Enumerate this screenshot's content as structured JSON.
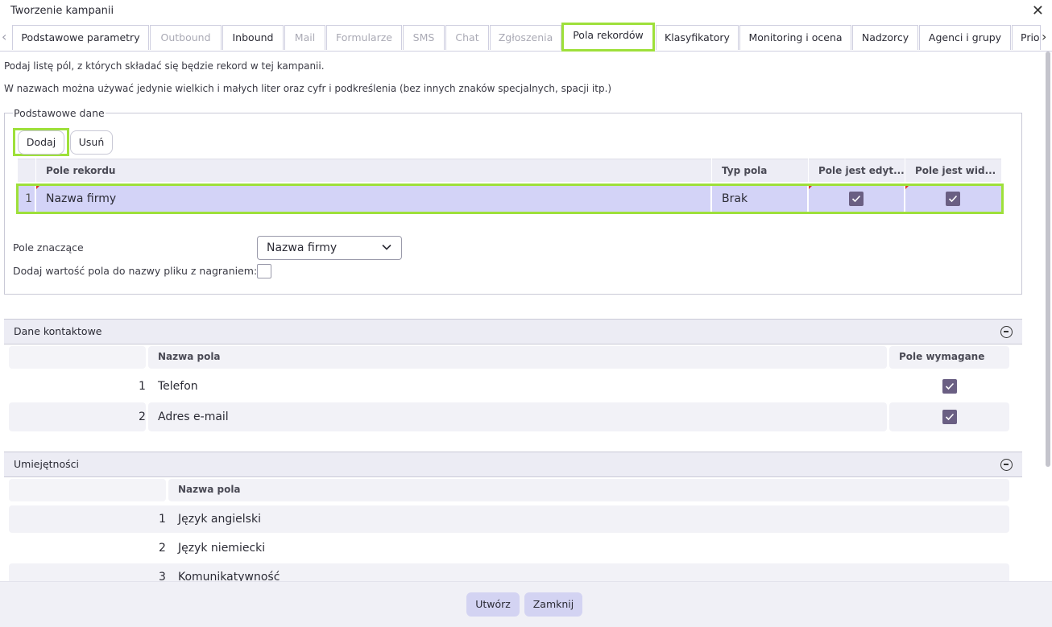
{
  "window": {
    "title": "Tworzenie kampanii"
  },
  "tabs": [
    {
      "label": "Podstawowe parametry",
      "state": "normal"
    },
    {
      "label": "Outbound",
      "state": "disabled"
    },
    {
      "label": "Inbound",
      "state": "normal"
    },
    {
      "label": "Mail",
      "state": "disabled"
    },
    {
      "label": "Formularze",
      "state": "disabled"
    },
    {
      "label": "SMS",
      "state": "disabled"
    },
    {
      "label": "Chat",
      "state": "disabled"
    },
    {
      "label": "Zgłoszenia",
      "state": "disabled"
    },
    {
      "label": "Pola rekordów",
      "state": "active"
    },
    {
      "label": "Klasyfikatory",
      "state": "normal"
    },
    {
      "label": "Monitoring i ocena",
      "state": "normal"
    },
    {
      "label": "Nadzorcy",
      "state": "normal"
    },
    {
      "label": "Agenci i grupy",
      "state": "normal"
    },
    {
      "label": "Prio",
      "state": "normal"
    }
  ],
  "intro": {
    "line1": "Podaj listę pól, z których składać się będzie rekord w tej kampanii.",
    "line2": "W nazwach można używać jedynie wielkich i małych liter oraz cyfr i podkreślenia (bez innych znaków specjalnych, spacji itp.)"
  },
  "basic": {
    "legend": "Podstawowe dane",
    "add_label": "Dodaj",
    "remove_label": "Usuń",
    "columns": [
      "Pole rekordu",
      "Typ pola",
      "Pole jest edyt...",
      "Pole jest wid..."
    ],
    "rows": [
      {
        "index": "1",
        "name": "Nazwa firmy",
        "type": "Brak",
        "editable": true,
        "visible": true
      }
    ],
    "significant_label": "Pole znaczące",
    "significant_value": "Nazwa firmy",
    "append_label": "Dodaj wartość pola do nazwy pliku z nagraniem:",
    "append_checked": false
  },
  "contact": {
    "title": "Dane kontaktowe",
    "col_name": "Nazwa pola",
    "col_required": "Pole wymagane",
    "rows": [
      {
        "index": "1",
        "name": "Telefon",
        "required": true
      },
      {
        "index": "2",
        "name": "Adres e-mail",
        "required": true
      }
    ]
  },
  "skills": {
    "title": "Umiejętności",
    "col_name": "Nazwa pola",
    "rows": [
      {
        "index": "1",
        "name": "Język angielski"
      },
      {
        "index": "2",
        "name": "Język niemiecki"
      },
      {
        "index": "3",
        "name": "Komunikatywność"
      }
    ]
  },
  "footer": {
    "create_label": "Utwórz",
    "close_label": "Zamknij"
  },
  "colors": {
    "highlight": "#9ee03a",
    "selected_row": "#d3d3f7",
    "check": "#6a5f83"
  }
}
